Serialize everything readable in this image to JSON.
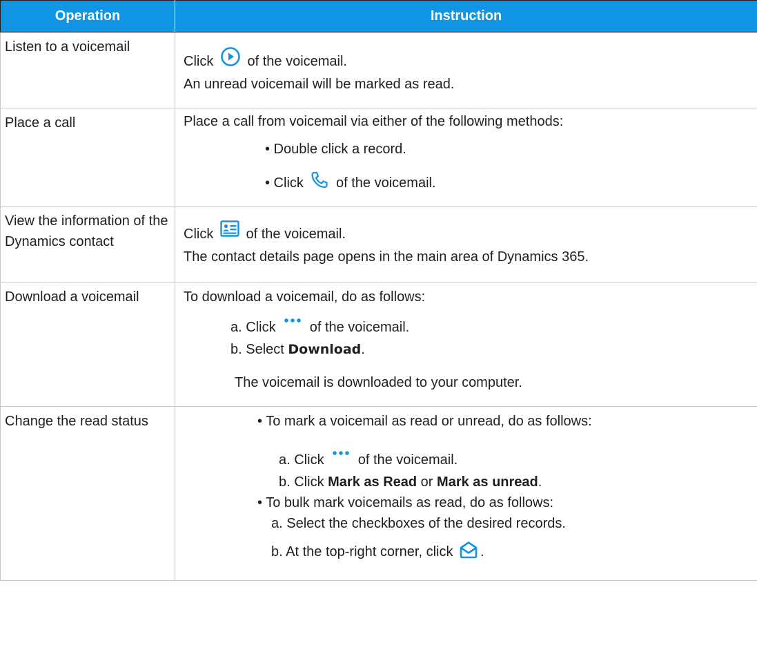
{
  "header": {
    "col1": "Operation",
    "col2": "Instruction"
  },
  "rows": [
    {
      "operation": "Listen to a voicemail",
      "lines": [
        {
          "click": "Click",
          "icon": "play-circle-icon",
          "after": "of the voicemail."
        },
        {
          "text": "An unread voicemail will be marked as read."
        }
      ]
    },
    {
      "operation": "Place a call",
      "lines": [
        {
          "text": "Place a call from voicemail via either of the following methods:"
        },
        {
          "text": "• Double click a record."
        },
        {
          "click": "• Click",
          "icon": "phone-icon",
          "after": "of the voicemail."
        }
      ]
    },
    {
      "operation": "View the information of the Dynamics contact",
      "lines": [
        {
          "click": "Click",
          "icon": "contact-card-icon",
          "after": "of the voicemail."
        },
        {
          "text": "The contact details page opens in the main area of Dynamics 365."
        }
      ]
    },
    {
      "operation": "Download a voicemail",
      "lines": [
        {
          "text": "To download a voicemail, do as follows:"
        },
        {
          "click": "a. Click",
          "icon": "more-dots-icon",
          "after": "of the voicemail."
        },
        {
          "prefix": "b. Select",
          "bold": "Download",
          "suffix": "."
        },
        {
          "text": "The voicemail is downloaded to your computer."
        }
      ]
    },
    {
      "operation": "Change the read status",
      "lines": [
        {
          "text": "• To mark a voicemail as read or unread, do as follows:"
        },
        {
          "click": "a. Click",
          "icon": "more-dots-icon",
          "after": "of the voicemail."
        },
        {
          "prefix": "b. Click",
          "bold": "Mark as Read",
          "mid": "or",
          "bold2": "Mark as unread",
          "suffix": "."
        },
        {
          "text": "• To bulk mark voicemails as read, do as follows:"
        },
        {
          "text": "a. Select the checkboxes of the desired records."
        },
        {
          "click": "b. At the top-right corner, click",
          "icon": "mark-read-envelope-icon",
          "after": "."
        }
      ]
    }
  ],
  "colors": {
    "header_bg": "#0f94e6",
    "icon_blue": "#0f94e6",
    "border": "#c8c8c8"
  }
}
